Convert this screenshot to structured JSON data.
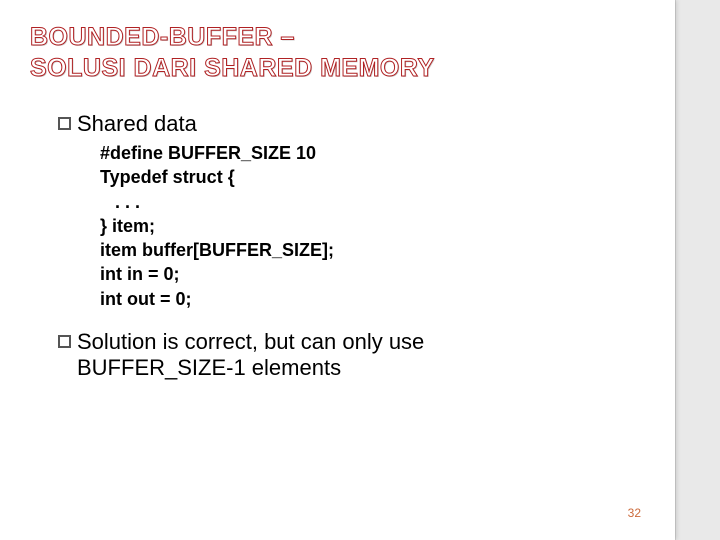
{
  "title_line1": "BOUNDED-BUFFER –",
  "title_line2": "SOLUSI DARI SHARED MEMORY",
  "bullet1": "Shared data",
  "code": "#define BUFFER_SIZE 10\nTypedef struct {\n   . . .\n} item;\nitem buffer[BUFFER_SIZE];\nint in = 0;\nint out = 0;",
  "bullet2_a": "Solution is correct, but can only use",
  "bullet2_b": "BUFFER_SIZE-1 elements",
  "page_number": "32"
}
